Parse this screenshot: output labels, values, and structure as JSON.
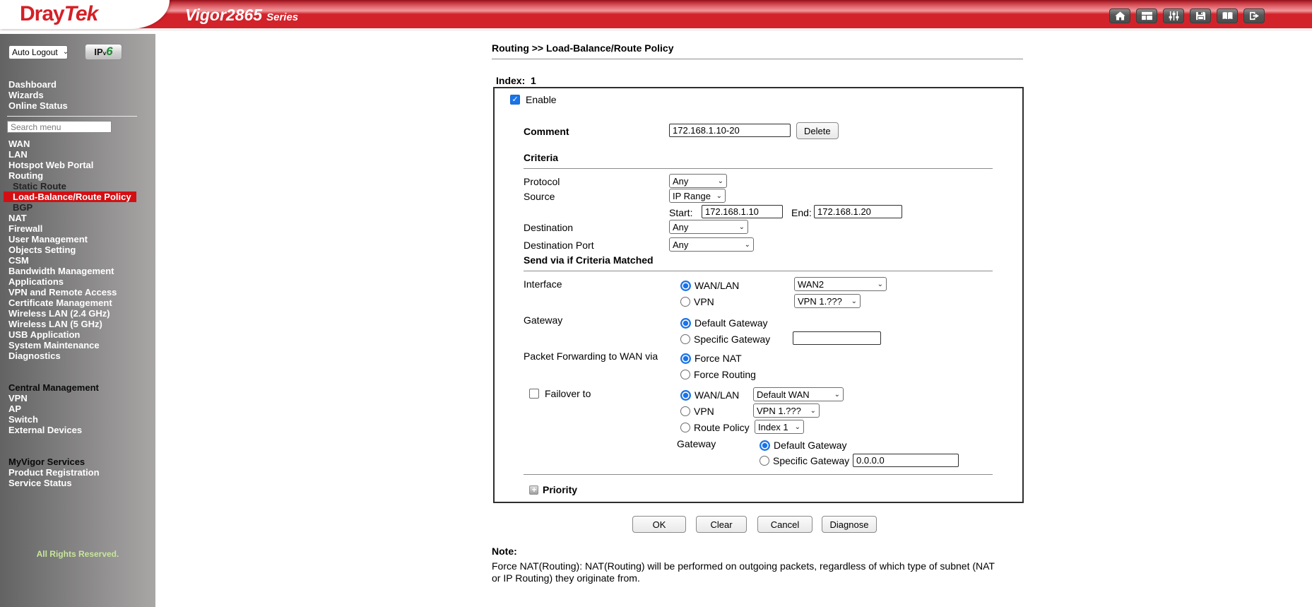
{
  "header": {
    "logo": {
      "dray": "Dray",
      "tek": "Tek"
    },
    "model": "Vigor2865",
    "series": "Series",
    "toolbar_icons": [
      "home-icon",
      "layout-icon",
      "sliders-icon",
      "save-icon",
      "manual-book-icon",
      "logout-icon"
    ]
  },
  "sidebar": {
    "logout_select": "Auto Logout",
    "ipv6_button": {
      "ip": "IP",
      "v": "v",
      "six": "6"
    },
    "top_links": [
      "Dashboard",
      "Wizards",
      "Online Status"
    ],
    "search_placeholder": "Search menu",
    "menu": [
      {
        "label": "WAN",
        "type": "item"
      },
      {
        "label": "LAN",
        "type": "item"
      },
      {
        "label": "Hotspot Web Portal",
        "type": "item"
      },
      {
        "label": "Routing",
        "type": "item"
      },
      {
        "label": "Static Route",
        "type": "sub"
      },
      {
        "label": "Load-Balance/Route Policy",
        "type": "sub-active"
      },
      {
        "label": "BGP",
        "type": "sub"
      },
      {
        "label": "NAT",
        "type": "item"
      },
      {
        "label": "Firewall",
        "type": "item"
      },
      {
        "label": "User Management",
        "type": "item"
      },
      {
        "label": "Objects Setting",
        "type": "item"
      },
      {
        "label": "CSM",
        "type": "item"
      },
      {
        "label": "Bandwidth Management",
        "type": "item"
      },
      {
        "label": "Applications",
        "type": "item"
      },
      {
        "label": "VPN and Remote Access",
        "type": "item"
      },
      {
        "label": "Certificate Management",
        "type": "item"
      },
      {
        "label": "Wireless LAN (2.4 GHz)",
        "type": "item"
      },
      {
        "label": "Wireless LAN (5 GHz)",
        "type": "item"
      },
      {
        "label": "USB Application",
        "type": "item"
      },
      {
        "label": "System Maintenance",
        "type": "item"
      },
      {
        "label": "Diagnostics",
        "type": "item"
      }
    ],
    "sections": [
      {
        "header": "Central Management",
        "items": [
          "VPN",
          "AP",
          "Switch",
          "External Devices"
        ]
      },
      {
        "header": "MyVigor Services",
        "items": [
          "Product Registration",
          "Service Status"
        ]
      }
    ],
    "footer": "All Rights Reserved."
  },
  "main": {
    "breadcrumb": "Routing >> Load-Balance/Route Policy",
    "index_label": "Index:",
    "index_value": "1",
    "form": {
      "enable_label": "Enable",
      "comment_label": "Comment",
      "comment_value": "172.168.1.10-20",
      "delete_button": "Delete",
      "criteria_header": "Criteria",
      "protocol_label": "Protocol",
      "protocol_value": "Any",
      "source_label": "Source",
      "source_value": "IP Range",
      "start_label": "Start:",
      "start_value": "172.168.1.10",
      "end_label": "End:",
      "end_value": "172.168.1.20",
      "destination_label": "Destination",
      "destination_value": "Any",
      "destination_port_label": "Destination Port",
      "destination_port_value": "Any",
      "send_via_header": "Send via if Criteria Matched",
      "interface_label": "Interface",
      "wan_lan_label": "WAN/LAN",
      "wan_lan_value": "WAN2",
      "vpn_label": "VPN",
      "vpn_value": "VPN 1.???",
      "gateway_label": "Gateway",
      "default_gateway_label": "Default Gateway",
      "specific_gateway_label": "Specific Gateway",
      "specific_gateway_value": "",
      "packet_forwarding_label": "Packet Forwarding to WAN via",
      "force_nat_label": "Force NAT",
      "force_routing_label": "Force Routing",
      "failover_label": "Failover to",
      "failover_wan_lan_label": "WAN/LAN",
      "failover_wan_lan_value": "Default WAN",
      "failover_vpn_label": "VPN",
      "failover_vpn_value": "VPN 1.???",
      "route_policy_label": "Route Policy",
      "route_policy_value": "Index 1",
      "failover_gateway_label": "Gateway",
      "failover_default_gateway_label": "Default Gateway",
      "failover_specific_gateway_label": "Specific Gateway",
      "failover_specific_gateway_value": "0.0.0.0",
      "priority_label": "Priority"
    },
    "buttons": [
      "OK",
      "Clear",
      "Cancel",
      "Diagnose"
    ],
    "note_header": "Note:",
    "note_text": "Force NAT(Routing): NAT(Routing) will be performed on outgoing packets, regardless of which type of subnet (NAT or IP Routing) they originate from."
  }
}
